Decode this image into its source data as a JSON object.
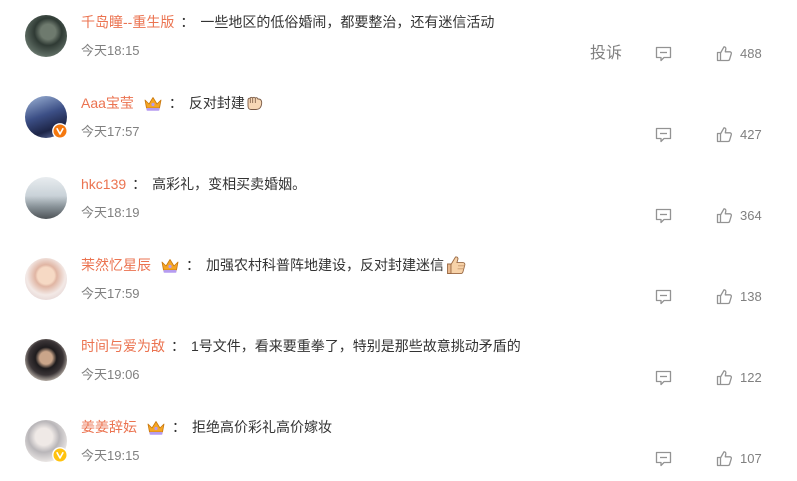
{
  "separator": "：",
  "report_label": "投诉",
  "colors": {
    "username": "#eb7350",
    "text": "#333333",
    "meta": "#808080",
    "icon": "#939393"
  },
  "comments": [
    {
      "user": "千岛瞳--重生版",
      "badge": null,
      "verified_badge": null,
      "text": "一些地区的低俗婚闹，都要整治，还有迷信活动",
      "emoji": null,
      "time": "今天18:15",
      "likes": "488"
    },
    {
      "user": "Aaa宝莹",
      "badge": "crown-badge-icon",
      "verified_badge": "orange-verified-icon",
      "text": "反对封建",
      "emoji": "fist-emoji-icon",
      "time": "今天17:57",
      "likes": "427"
    },
    {
      "user": "hkc139",
      "badge": null,
      "verified_badge": null,
      "text": "高彩礼，变相买卖婚姻。",
      "emoji": null,
      "time": "今天18:19",
      "likes": "364"
    },
    {
      "user": "茉然忆星辰",
      "badge": "crown-badge-icon",
      "verified_badge": null,
      "text": "加强农村科普阵地建设，反对封建迷信",
      "emoji": "thumbs-up-emoji-icon",
      "time": "今天17:59",
      "likes": "138"
    },
    {
      "user": "时间与爱为敌",
      "badge": null,
      "verified_badge": null,
      "text": "1号文件，看来要重拳了，特别是那些故意挑动矛盾的",
      "emoji": null,
      "time": "今天19:06",
      "likes": "122"
    },
    {
      "user": "姜姜辞妘",
      "badge": "crown-badge-icon",
      "verified_badge": "yellow-verified-icon",
      "text": "拒绝高价彩礼高价嫁妆",
      "emoji": null,
      "time": "今天19:15",
      "likes": "107"
    }
  ]
}
